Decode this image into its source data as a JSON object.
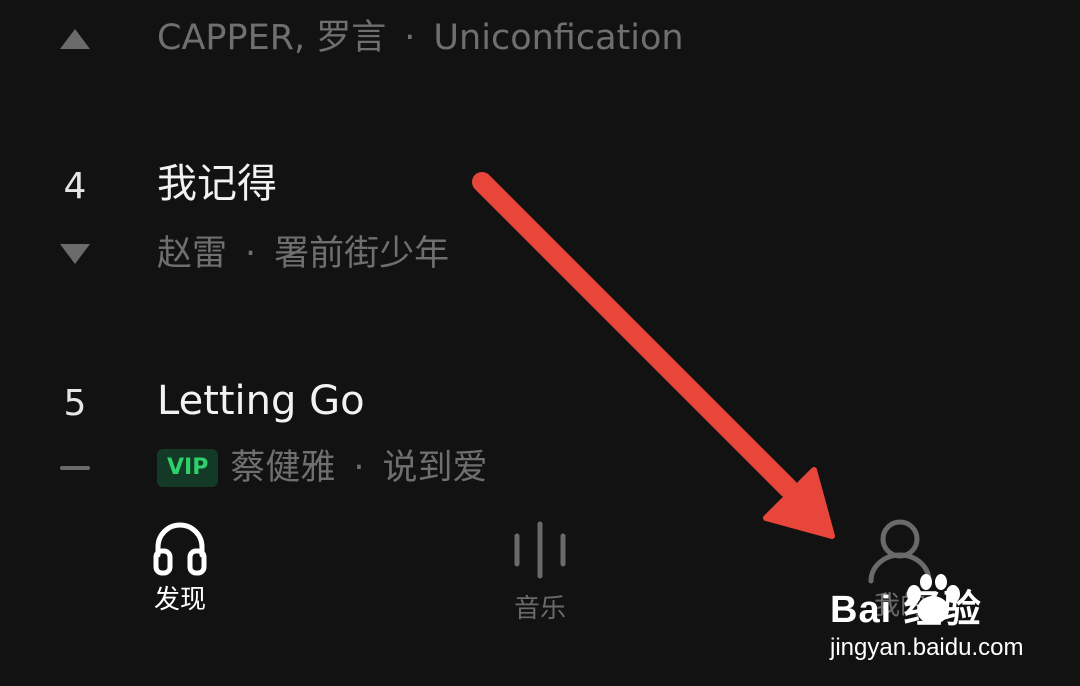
{
  "chart_list": [
    {
      "rank": "",
      "trend": "up",
      "title": "",
      "artist": "CAPPER, 罗言",
      "album": "Uniconfication",
      "vip": false
    },
    {
      "rank": "4",
      "trend": "down",
      "title": "我记得",
      "artist": "赵雷",
      "album": "署前街少年",
      "vip": false
    },
    {
      "rank": "5",
      "trend": "same",
      "title": "Letting Go",
      "artist": "蔡健雅",
      "album": "说到爱",
      "vip": true,
      "vip_label": "VIP"
    }
  ],
  "separator": "·",
  "bottom_nav": {
    "tabs": [
      {
        "label": "发现",
        "icon": "headphones-icon",
        "active": true
      },
      {
        "label": "音乐",
        "icon": "sound-bars-icon",
        "active": false
      },
      {
        "label": "我的",
        "icon": "person-icon",
        "active": false
      }
    ]
  },
  "watermark": {
    "logo": "Bai 经验",
    "url": "jingyan.baidu.com"
  },
  "colors": {
    "background": "#121212",
    "arrow": "#e8463a",
    "vip_text": "#2fcf6b",
    "vip_bg": "#123a26",
    "muted": "#6f6f6f"
  }
}
